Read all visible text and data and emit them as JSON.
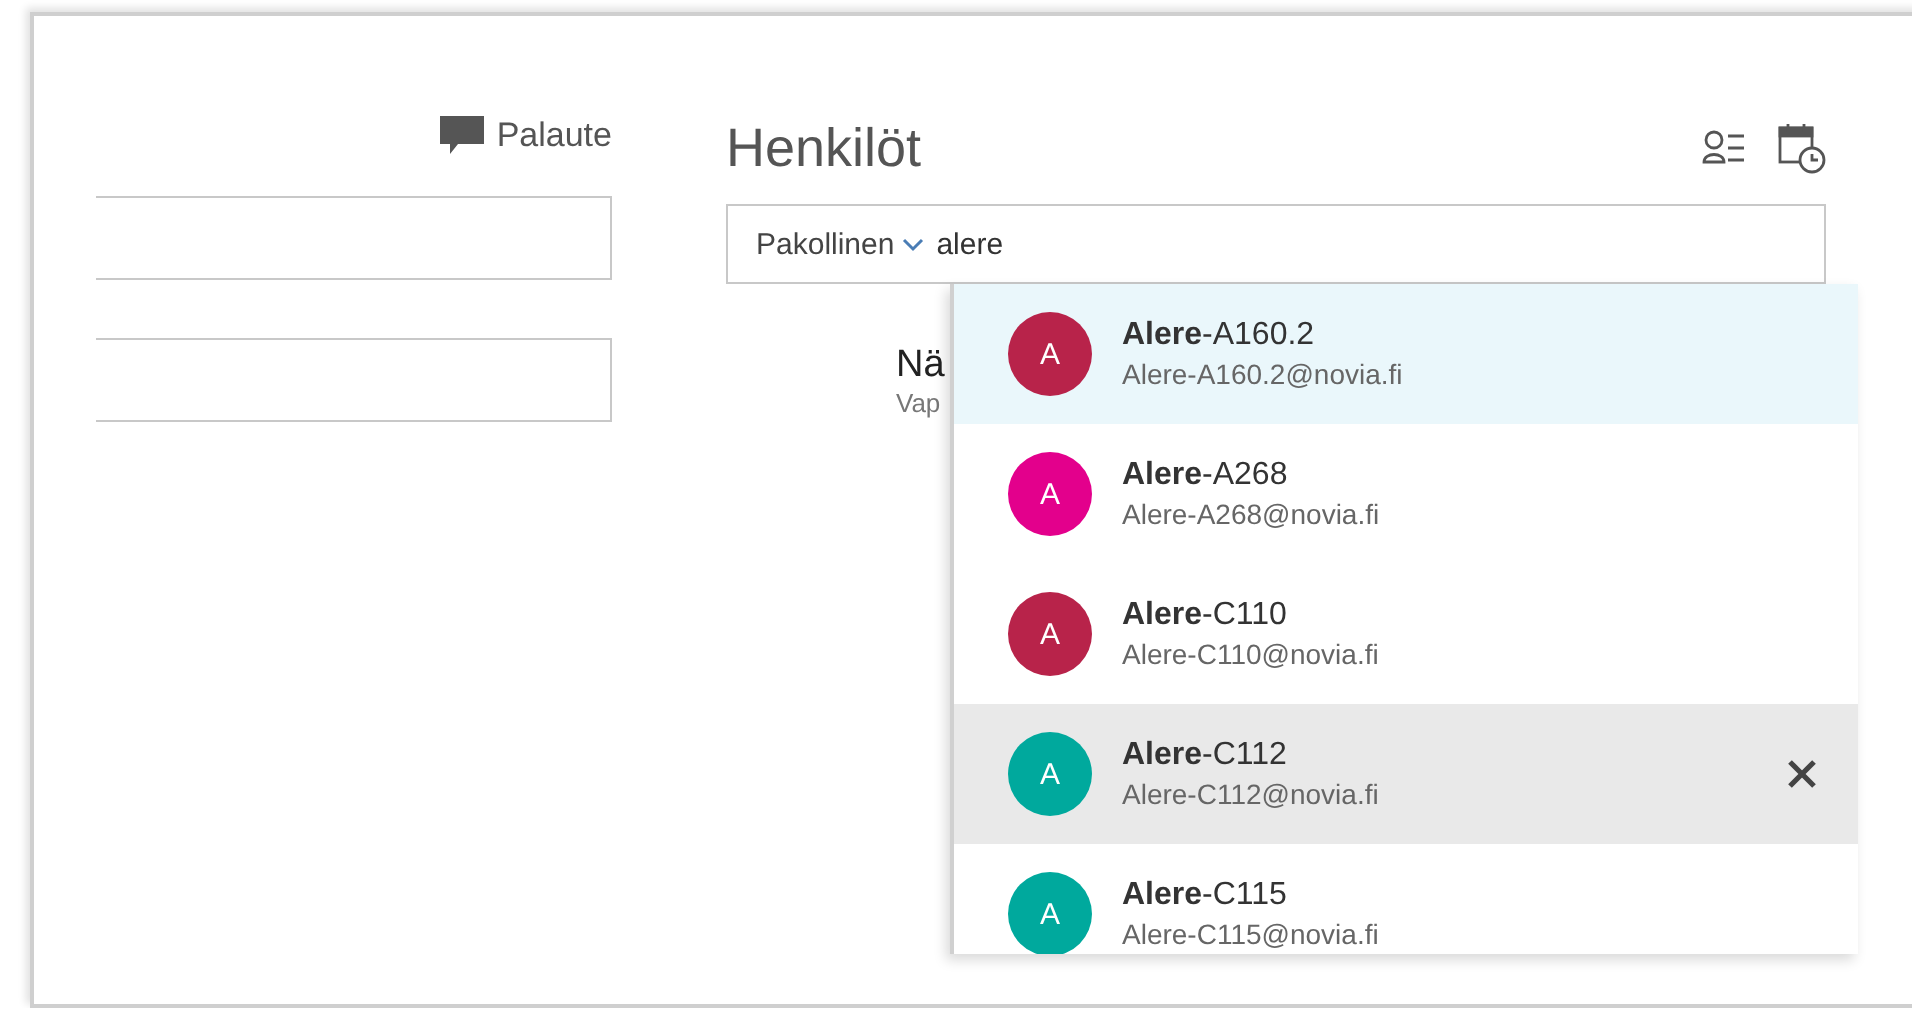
{
  "feedback": {
    "label": "Palaute"
  },
  "people": {
    "title": "Henkilöt",
    "filter": {
      "label": "Pakollinen"
    },
    "search_value": "alere"
  },
  "behind": {
    "title": "Nä",
    "subtitle": "Vap"
  },
  "suggestions": [
    {
      "name": "**Alere**-A160.2",
      "email": "Alere-A160.2@novia.fi",
      "initial": "A",
      "color": "#b8234a",
      "selected": true,
      "hovered": false
    },
    {
      "name": "**Alere**-A268",
      "email": "Alere-A268@novia.fi",
      "initial": "A",
      "color": "#e3008c",
      "selected": false,
      "hovered": false
    },
    {
      "name": "**Alere**-C110",
      "email": "Alere-C110@novia.fi",
      "initial": "A",
      "color": "#b8234a",
      "selected": false,
      "hovered": false
    },
    {
      "name": "**Alere**-C112",
      "email": "Alere-C112@novia.fi",
      "initial": "A",
      "color": "#00a99d",
      "selected": false,
      "hovered": true
    },
    {
      "name": "**Alere**-C115",
      "email": "Alere-C115@novia.fi",
      "initial": "A",
      "color": "#00a99d",
      "selected": false,
      "hovered": false
    }
  ]
}
